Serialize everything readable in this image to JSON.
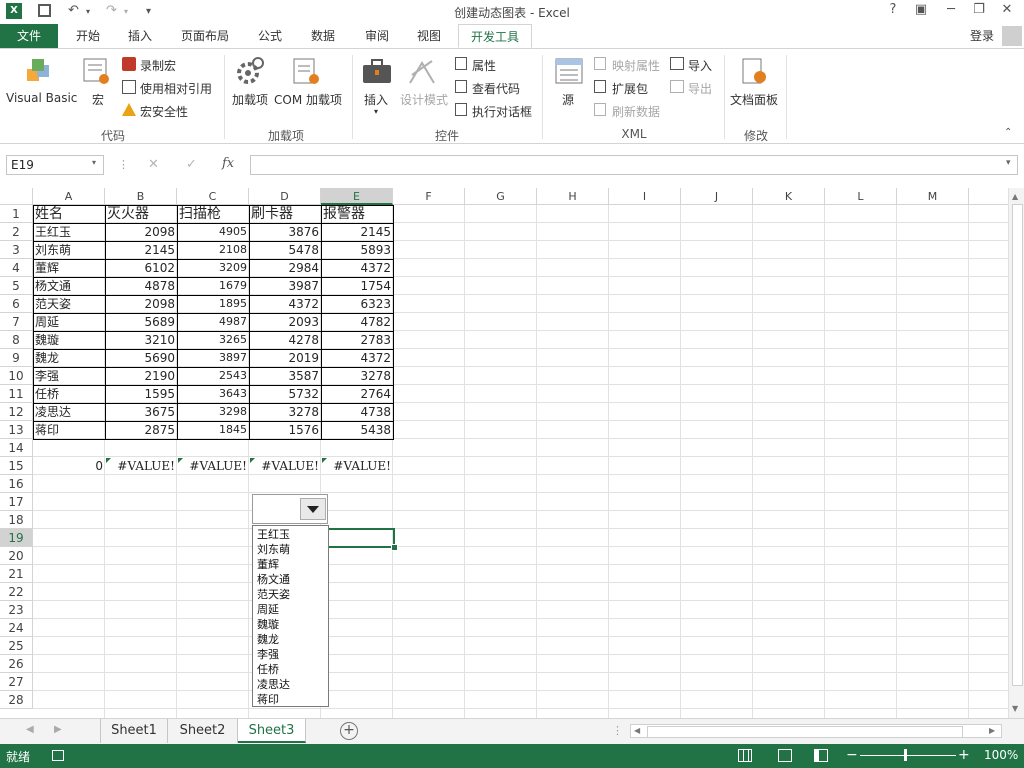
{
  "window": {
    "title": "创建动态图表 - Excel",
    "help": "?",
    "restore_ribbon": "▣",
    "minimize": "─",
    "maximize": "❐",
    "close": "✕",
    "signin": "登录"
  },
  "tabs": [
    "文件",
    "开始",
    "插入",
    "页面布局",
    "公式",
    "数据",
    "审阅",
    "视图",
    "开发工具"
  ],
  "ribbon": {
    "code": {
      "visual_basic": "Visual Basic",
      "macros": "宏",
      "record": "录制宏",
      "relative": "使用相对引用",
      "security": "宏安全性",
      "group": "代码"
    },
    "addins": {
      "addins": "加载项",
      "com": "COM 加载项",
      "group": "加载项"
    },
    "controls": {
      "insert": "插入",
      "design": "设计模式",
      "properties": "属性",
      "view_code": "查看代码",
      "dialog": "执行对话框",
      "group": "控件"
    },
    "xml": {
      "source": "源",
      "map_props": "映射属性",
      "expansion": "扩展包",
      "refresh": "刷新数据",
      "import": "导入",
      "export": "导出",
      "group": "XML"
    },
    "modify": {
      "doc_panel": "文档面板",
      "group": "修改"
    }
  },
  "formula_bar": {
    "name_box": "E19",
    "cancel": "✕",
    "enter": "✓",
    "fx": "fx",
    "value": ""
  },
  "columns": [
    "A",
    "B",
    "C",
    "D",
    "E",
    "F",
    "G",
    "H",
    "I",
    "J",
    "K",
    "L",
    "M"
  ],
  "rows": [
    "1",
    "2",
    "3",
    "4",
    "5",
    "6",
    "7",
    "8",
    "9",
    "10",
    "11",
    "12",
    "13",
    "14",
    "15",
    "16",
    "17",
    "18",
    "19",
    "20",
    "21",
    "22",
    "23",
    "24",
    "25",
    "26",
    "27",
    "28"
  ],
  "table": {
    "headers": [
      "姓名",
      "灭火器",
      "扫描枪",
      "刷卡器",
      "报警器"
    ],
    "rows": [
      [
        "王红玉",
        "2098",
        "4905",
        "3876",
        "2145"
      ],
      [
        "刘东萌",
        "2145",
        "2108",
        "5478",
        "5893"
      ],
      [
        "董辉",
        "6102",
        "3209",
        "2984",
        "4372"
      ],
      [
        "杨文通",
        "4878",
        "1679",
        "3987",
        "1754"
      ],
      [
        "范天姿",
        "2098",
        "1895",
        "4372",
        "6323"
      ],
      [
        "周延",
        "5689",
        "4987",
        "2093",
        "4782"
      ],
      [
        "魏璇",
        "3210",
        "3265",
        "4278",
        "2783"
      ],
      [
        "魏龙",
        "5690",
        "3897",
        "2019",
        "4372"
      ],
      [
        "李强",
        "2190",
        "2543",
        "3587",
        "3278"
      ],
      [
        "任桥",
        "1595",
        "3643",
        "5732",
        "2764"
      ],
      [
        "凌思达",
        "3675",
        "3298",
        "3278",
        "4738"
      ],
      [
        "蒋印",
        "2875",
        "1845",
        "1576",
        "5438"
      ]
    ]
  },
  "row15": [
    "0",
    "#VALUE!",
    "#VALUE!",
    "#VALUE!",
    "#VALUE!"
  ],
  "dropdown": {
    "items": [
      "王红玉",
      "刘东萌",
      "董辉",
      "杨文通",
      "范天姿",
      "周延",
      "魏璇",
      "魏龙",
      "李强",
      "任桥",
      "凌思达",
      "蒋印"
    ]
  },
  "sheets": [
    "Sheet1",
    "Sheet2",
    "Sheet3"
  ],
  "add_sheet": "+",
  "status": {
    "ready": "就绪",
    "zoom": "100%",
    "minus": "−",
    "plus": "+"
  },
  "colors": {
    "accent": "#217346"
  }
}
